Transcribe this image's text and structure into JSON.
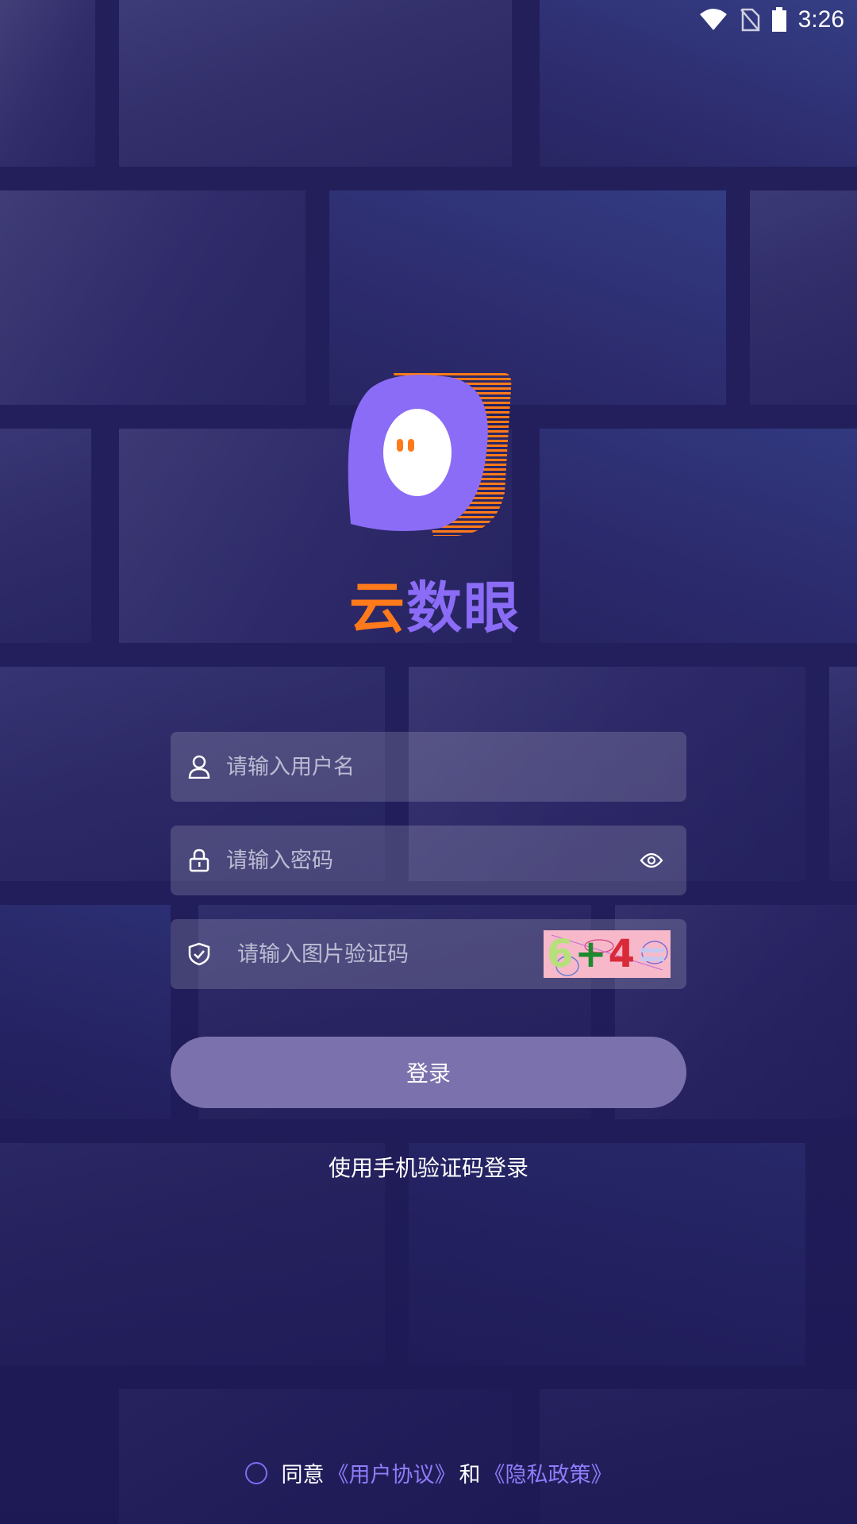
{
  "status_bar": {
    "time": "3:26",
    "icons": [
      "wifi-icon",
      "no-sim-icon",
      "battery-icon"
    ]
  },
  "logo": {
    "icon": "ghost-logo-icon",
    "name_part1": "云",
    "name_part2": "数眼",
    "colors": {
      "orange": "#ff7a1a",
      "purple": "#8b6cf6"
    }
  },
  "form": {
    "username": {
      "placeholder": "请输入用户名",
      "value": "",
      "icon": "user-icon"
    },
    "password": {
      "placeholder": "请输入密码",
      "value": "",
      "icon": "lock-icon",
      "toggle_icon": "eye-icon"
    },
    "captcha": {
      "placeholder": "请输入图片验证码",
      "value": "",
      "icon": "shield-check-icon",
      "image_text": "6+4="
    }
  },
  "login_button": {
    "label": "登录",
    "color": "#7b72ad"
  },
  "sms_login": {
    "label": "使用手机验证码登录"
  },
  "agreement": {
    "prefix": "同意",
    "user_agreement": "《用户协议》",
    "and": "和",
    "privacy_policy": "《隐私政策》"
  }
}
